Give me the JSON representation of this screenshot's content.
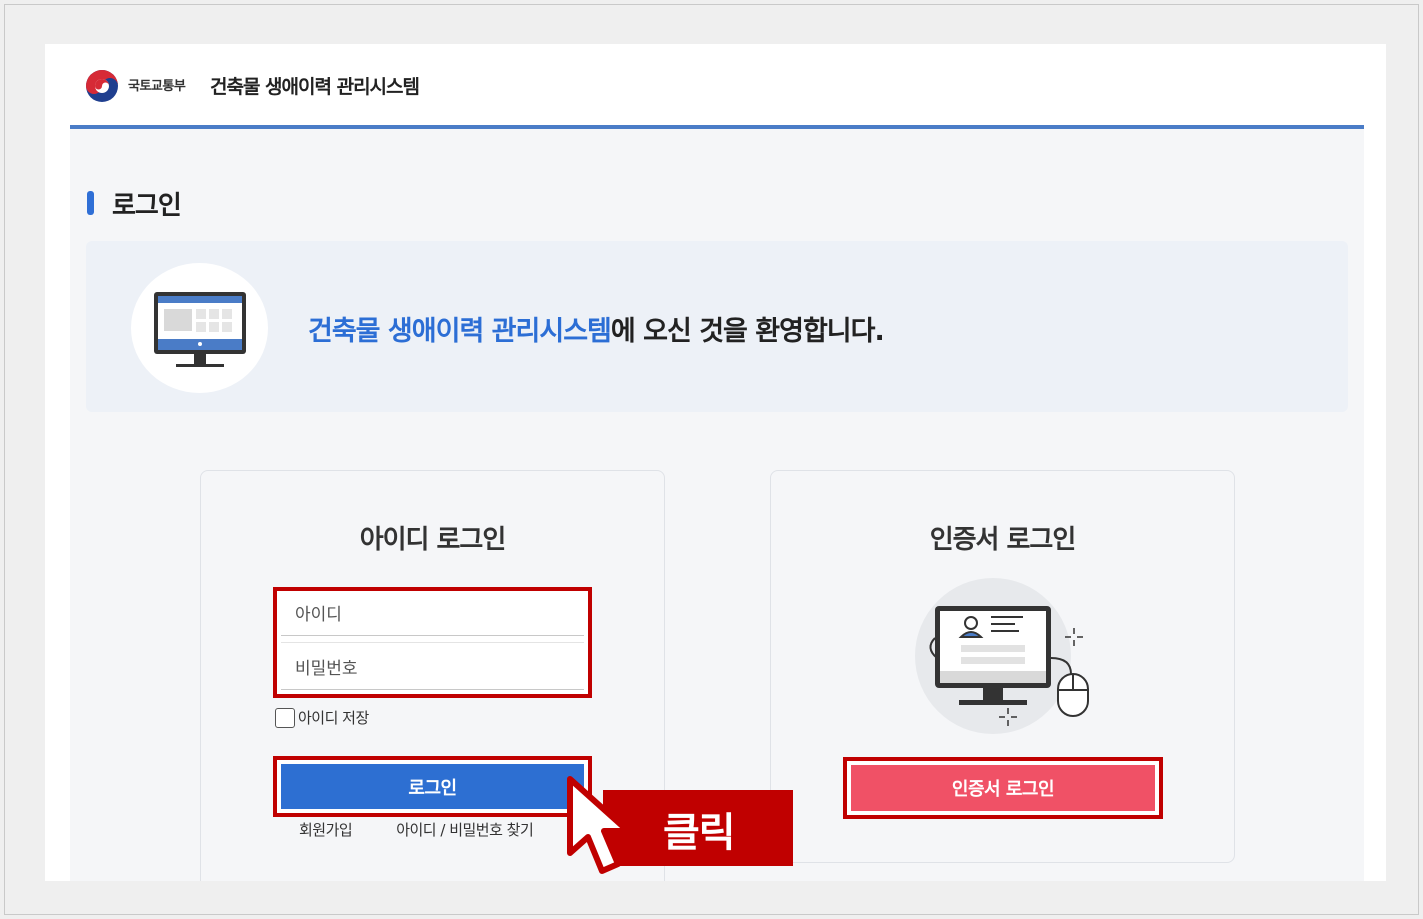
{
  "header": {
    "ministry": "국토교통부",
    "system_title": "건축물 생애이력 관리시스템"
  },
  "section": {
    "title": "로그인"
  },
  "welcome": {
    "highlight": "건축물 생애이력 관리시스템",
    "rest": "에 오신 것을 환영합니다."
  },
  "id_login": {
    "title": "아이디 로그인",
    "id_placeholder": "아이디",
    "pw_placeholder": "비밀번호",
    "remember_label": "아이디 저장",
    "login_button": "로그인",
    "signup_link": "회원가입",
    "find_link": "아이디 / 비밀번호 찾기"
  },
  "cert_login": {
    "title": "인증서 로그인",
    "button": "인증서 로그인"
  },
  "annotation": {
    "click_label": "클릭"
  },
  "colors": {
    "accent_blue": "#2d6fd2",
    "cert_pink": "#f05166",
    "highlight_red": "#c00000",
    "header_rule": "#4a7cc7"
  },
  "icons": [
    "government-emblem-icon",
    "monitor-icon",
    "certificate-monitor-icon",
    "mouse-pointer-icon"
  ]
}
